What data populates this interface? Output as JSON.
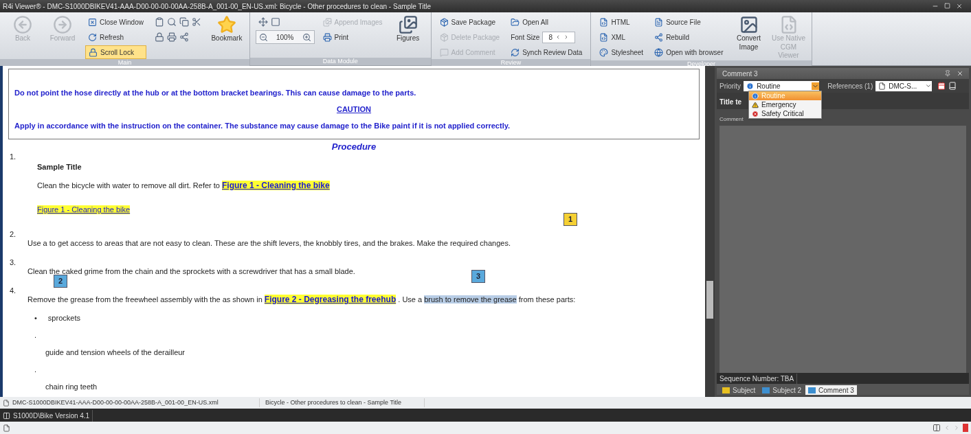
{
  "window": {
    "title": "R4i Viewer® - DMC-S1000DBIKEV41-AAA-D00-00-00-00AA-258B-A_001-00_EN-US.xml: Bicycle - Other procedures to clean - Sample Title"
  },
  "ribbon": [
    {
      "label": "Main",
      "columns": [
        [
          {
            "kind": "large",
            "label": "Back",
            "disabled": true
          }
        ],
        [
          {
            "kind": "large",
            "label": "Forward",
            "disabled": true
          }
        ],
        [
          {
            "kind": "small",
            "label": "Close Window",
            "disabled": false,
            "on": false
          },
          {
            "kind": "small",
            "label": "Refresh",
            "disabled": false,
            "on": false
          },
          {
            "kind": "small",
            "label": "Scroll Lock",
            "disabled": false,
            "on": true
          }
        ],
        [
          {
            "kind": "icons"
          },
          {
            "kind": "icons"
          }
        ],
        [
          {
            "kind": "large",
            "label": "Bookmark",
            "disabled": false
          }
        ]
      ]
    },
    {
      "label": "Data Module",
      "columns": [
        [
          {
            "kind": "icons"
          },
          {
            "kind": "zoom",
            "value": "100%"
          }
        ],
        [
          {
            "kind": "small",
            "label": "Append Images",
            "disabled": true,
            "on": false
          },
          {
            "kind": "small",
            "label": "Print",
            "disabled": false,
            "on": false
          }
        ],
        [
          {
            "kind": "large",
            "label": "Figures",
            "disabled": false
          }
        ]
      ]
    },
    {
      "label": "Review",
      "columns": [
        [
          {
            "kind": "small",
            "label": "Save Package",
            "disabled": false,
            "on": false
          },
          {
            "kind": "small",
            "label": "Delete Package",
            "disabled": true,
            "on": false
          },
          {
            "kind": "small",
            "label": "Add Comment",
            "disabled": true,
            "on": false
          }
        ],
        [
          {
            "kind": "small",
            "label": "Open All",
            "disabled": false,
            "on": false
          },
          {
            "kind": "spinner",
            "label": "Font Size",
            "value": "8"
          },
          {
            "kind": "small",
            "label": "Synch Review Data",
            "disabled": false,
            "on": false
          }
        ]
      ]
    },
    {
      "label": "Developer",
      "columns": [
        [
          {
            "kind": "small",
            "label": "HTML",
            "disabled": false,
            "on": false
          },
          {
            "kind": "small",
            "label": "XML",
            "disabled": false,
            "on": false
          },
          {
            "kind": "small",
            "label": "Stylesheet",
            "disabled": false,
            "on": false
          }
        ],
        [
          {
            "kind": "small",
            "label": "Source File",
            "disabled": false,
            "on": false
          },
          {
            "kind": "small",
            "label": "Rebuild",
            "disabled": false,
            "on": false
          },
          {
            "kind": "small",
            "label": "Open with browser",
            "disabled": false,
            "on": false
          }
        ],
        [
          {
            "kind": "large",
            "label": "Convert Image",
            "disabled": false
          }
        ],
        [
          {
            "kind": "large",
            "label": "Use Native CGM Viewer",
            "disabled": true
          }
        ]
      ]
    }
  ],
  "document": {
    "warning": "Do not point the hose directly at the hub or at the bottom bracket bearings. This can cause damage to the parts.",
    "caution_heading": "CAUTION",
    "caution": "Apply in accordance with the instruction on the container. The substance may cause damage to the Bike paint if it is not applied correctly.",
    "heading": "Procedure",
    "steps": [
      {
        "number": "1.",
        "title": "Sample Title",
        "parts": [
          {
            "kind": "text",
            "text": "Clean the bicycle with water to remove all dirt. Refer to "
          },
          {
            "kind": "link",
            "text": "Figure 1 - Cleaning the bike"
          }
        ],
        "figure": "Figure 1 - Cleaning the bike"
      },
      {
        "number": "2.",
        "parts": [
          {
            "kind": "text",
            "text": "Use a to get access to areas that are not easy to clean. These are the shift levers, the knobbly tires, and the brakes. Make the required changes."
          }
        ]
      },
      {
        "number": "3.",
        "parts": [
          {
            "kind": "text",
            "text": "Clean the caked grime from the chain and the sprockets with a screwdriver that has a small blade."
          }
        ]
      },
      {
        "number": "4.",
        "parts": [
          {
            "kind": "text",
            "text": "Remove the grease from the freewheel assembly with the as shown in "
          },
          {
            "kind": "link",
            "text": "Figure 2 - Degreasing the freehub"
          },
          {
            "kind": "text",
            "text": " . Use a "
          },
          {
            "kind": "selection",
            "text": "brush to remove the grease"
          },
          {
            "kind": "text",
            "text": " from these parts:"
          }
        ],
        "list": [
          {
            "marker": "•",
            "text": "sprockets"
          },
          {
            "marker": ".",
            "text": "guide and tension wheels of the derailleur"
          },
          {
            "marker": ".",
            "text": "chain ring teeth"
          }
        ]
      }
    ],
    "comment_markers": [
      {
        "label": "1",
        "color": "#f5d033"
      },
      {
        "label": "2",
        "color": "#5aa9dc"
      },
      {
        "label": "3",
        "color": "#5aa9dc"
      }
    ]
  },
  "comment_panel": {
    "title": "Comment 3",
    "priority_label": "Priority",
    "priority_value": "Routine",
    "references_label": "References (1)",
    "references_value": "DMC-S...",
    "title_label": "Title te",
    "comment_label": "Comment",
    "priority_options": [
      {
        "kind": "info",
        "label": "Routine",
        "selected": true
      },
      {
        "kind": "warning",
        "label": "Emergency",
        "selected": false
      },
      {
        "kind": "critical",
        "label": "Safety Critical",
        "selected": false
      }
    ],
    "sequence": "Sequence Number: TBA",
    "tabs": [
      {
        "label": "Subject",
        "color": "#e8c020",
        "selected": false
      },
      {
        "label": "Subject 2",
        "color": "#3d8fd0",
        "selected": false
      },
      {
        "label": "Comment 3",
        "color": "#3d8fd0",
        "selected": true
      }
    ]
  },
  "status_bar": {
    "file": "DMC-S1000DBIKEV41-AAA-D00-00-00-00AA-258B-A_001-00_EN-US.xml",
    "title": "Bicycle - Other procedures to clean - Sample Title"
  },
  "project_tab": "S1000D\\Bike Version 4.1"
}
